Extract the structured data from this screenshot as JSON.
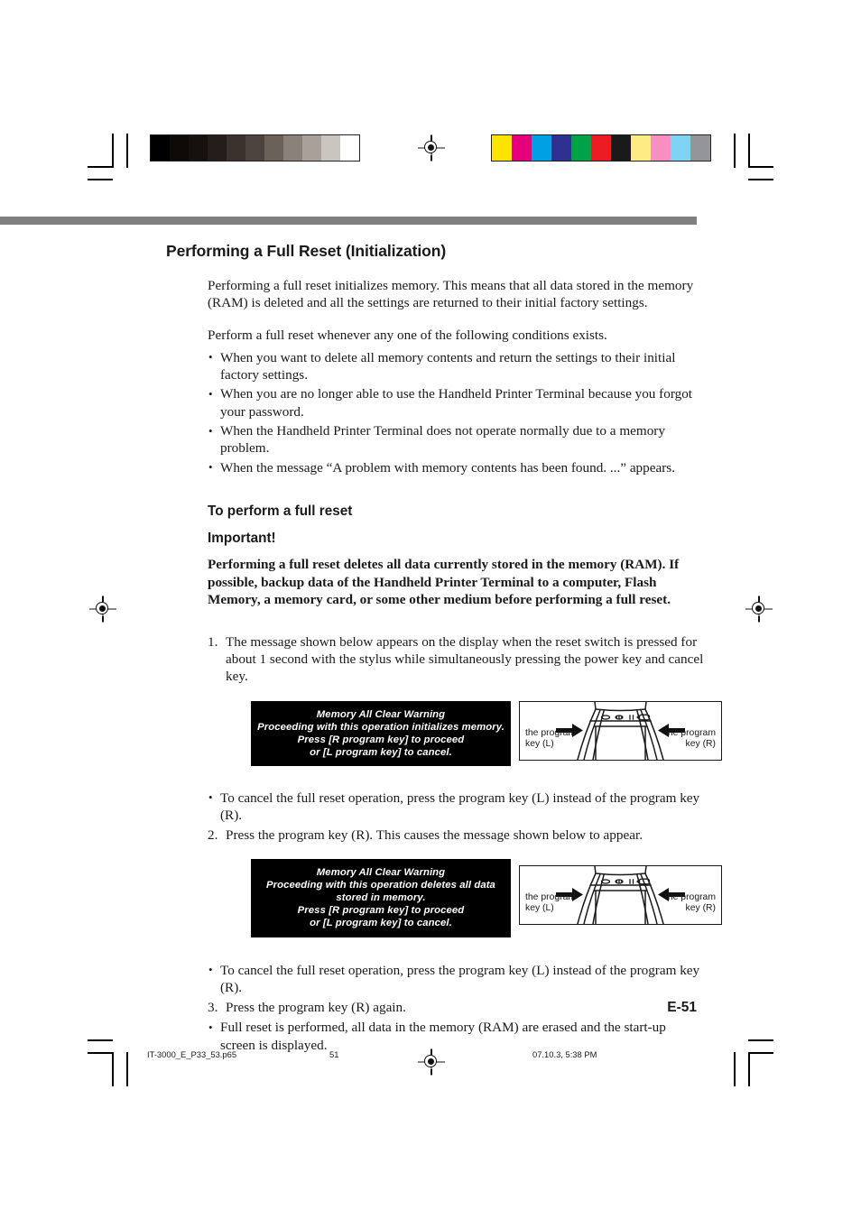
{
  "page": {
    "folio": "E-51",
    "title": "Performing a Full Reset (Initialization)"
  },
  "intro": {
    "paragraph1": "Performing a full reset initializes memory. This means that all data stored in the memory (RAM) is deleted and all the settings are returned to their initial factory settings.",
    "paragraph2": "Perform a full reset whenever any one of the following conditions exists."
  },
  "conditions": [
    "When you want to delete all memory contents and return the settings to their initial factory settings.",
    "When you are no longer able to use the Handheld Printer Terminal because you forgot your password.",
    "When the Handheld Printer Terminal does not operate normally due to a memory problem.",
    "When the message “A problem with memory contents has been found. ...” appears."
  ],
  "procedure": {
    "heading": "To perform a full reset",
    "important_label": "Important!",
    "important_body": "Performing a full reset deletes all data currently stored in the memory (RAM). If possible, backup data of the Handheld Printer Terminal to a computer, Flash Memory, a memory card, or some other medium before performing a full reset.",
    "steps": [
      {
        "num": "1.",
        "text": "The message shown below appears on the display when the reset switch is pressed for about 1 second with the stylus while simultaneously pressing the power key and cancel key."
      },
      {
        "num": "2.",
        "text": "Press the program key (R). This causes the message shown below to appear."
      },
      {
        "num": "3.",
        "text": "Press the program key (R) again."
      }
    ],
    "notes": {
      "cancel_note": "To cancel the full reset operation, press the program key (L) instead of the program key (R).",
      "final_note": "Full reset is performed, all data in the memory (RAM) are erased and the start-up screen is displayed."
    }
  },
  "figures": [
    {
      "lcd_lines": [
        "Memory All Clear Warning",
        "Proceeding with this operation initializes memory.",
        "Press [R program key]  to proceed",
        "or [L program key] to cancel."
      ],
      "device": {
        "label_left": [
          "the program",
          "key (L)"
        ],
        "label_right": [
          "the program",
          "key (R)"
        ]
      }
    },
    {
      "lcd_lines": [
        "Memory All Clear Warning",
        "Proceeding with this operation deletes all data",
        "stored in memory.",
        "Press [R program key]  to proceed",
        "or [L program key] to cancel."
      ],
      "device": {
        "label_left": [
          "the program",
          "key (L)"
        ],
        "label_right": [
          "the program",
          "key (R)"
        ]
      }
    }
  ],
  "footer": {
    "filename": "IT-3000_E_P33_53.p65",
    "page_number": "51",
    "timestamp": "07.10.3, 5:38 PM"
  },
  "print_marks": {
    "grayscale_swatches": [
      "#000000",
      "#0d0a08",
      "#16110f",
      "#241d1a",
      "#3a302c",
      "#4d433e",
      "#6b6158",
      "#8a817a",
      "#a9a099",
      "#cbc5c0",
      "#ffffff"
    ],
    "color_swatches": [
      "#fde400",
      "#e6007e",
      "#00a0e4",
      "#2e3192",
      "#00a14b",
      "#ed1c24",
      "#1a1a1a",
      "#fdeb83",
      "#f78fc0",
      "#7fd3f3",
      "#939598"
    ],
    "gray_bar_color": "#7f7f7f"
  }
}
